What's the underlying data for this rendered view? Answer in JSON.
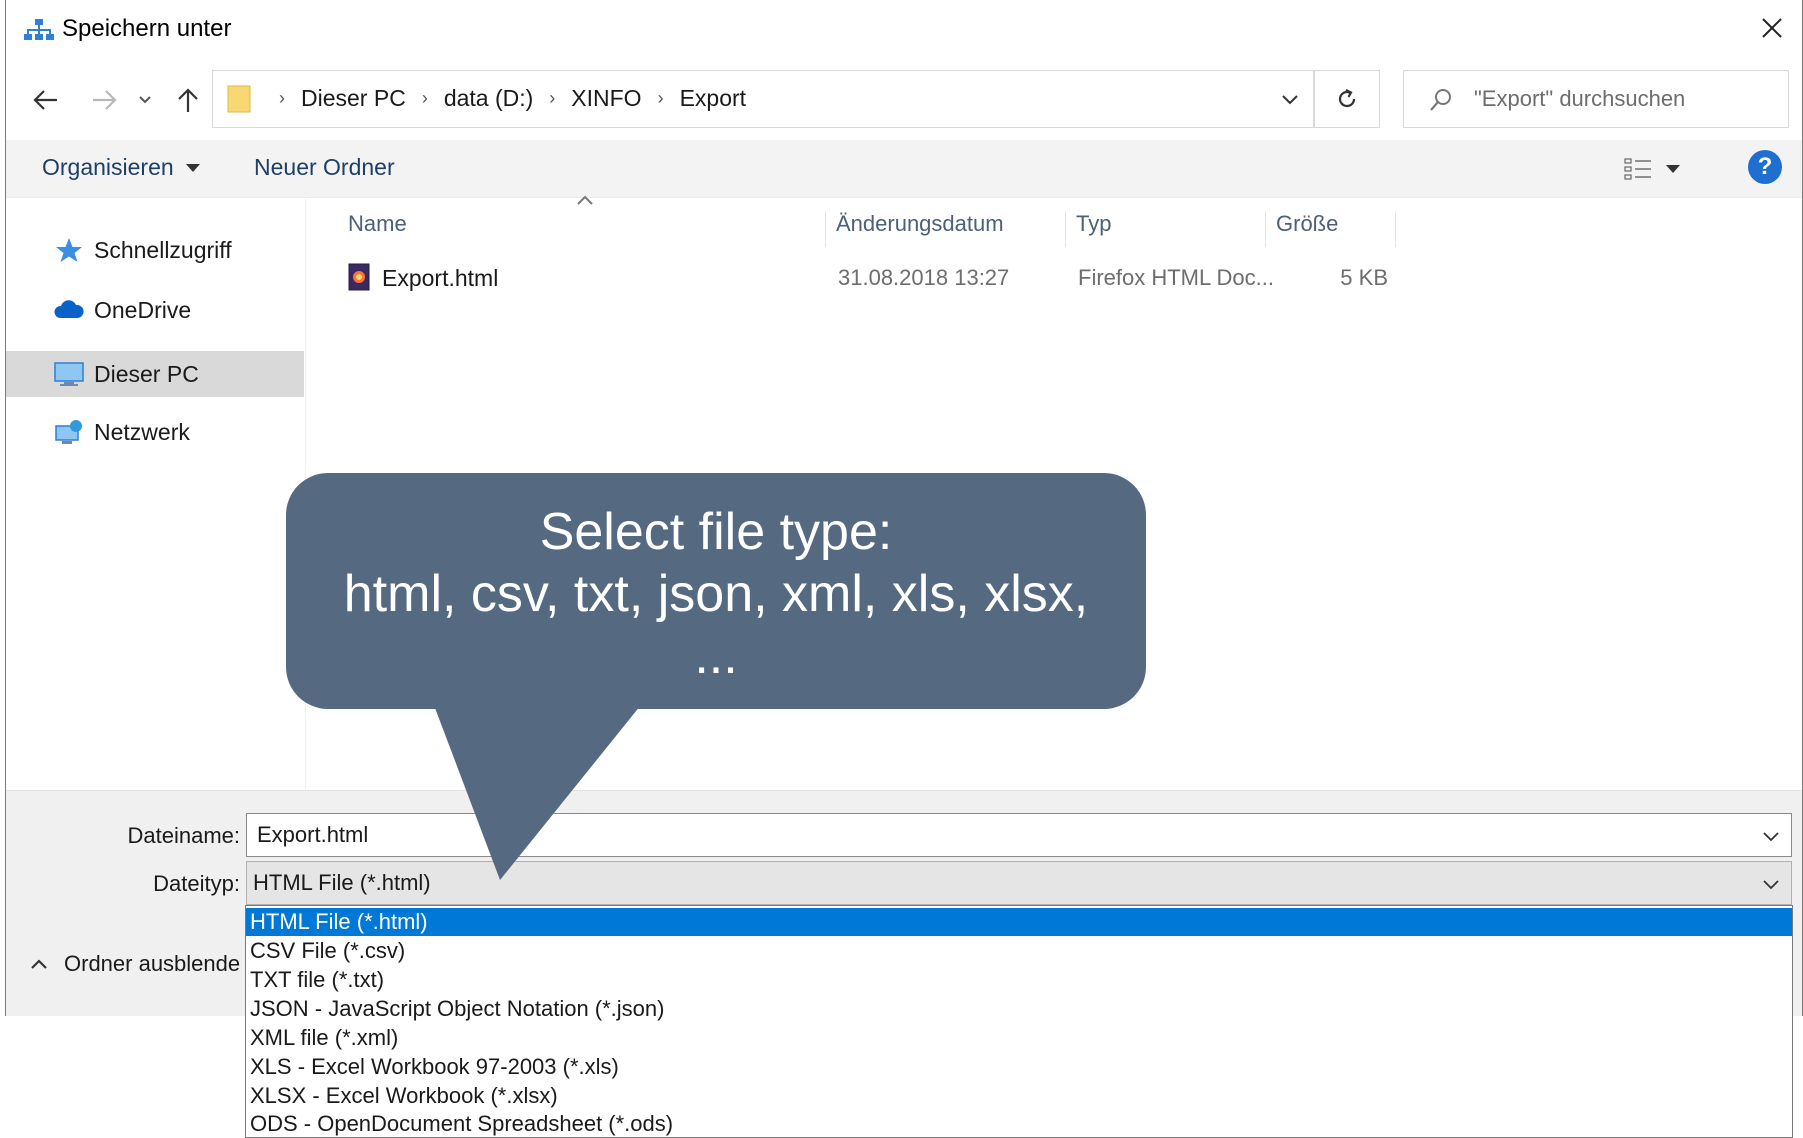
{
  "window": {
    "title": "Speichern unter"
  },
  "address": {
    "breadcrumb": [
      "Dieser PC",
      "data (D:)",
      "XINFO",
      "Export"
    ]
  },
  "search": {
    "placeholder": "\"Export\" durchsuchen"
  },
  "toolbar": {
    "organize_label": "Organisieren",
    "new_folder_label": "Neuer Ordner",
    "help_label": "?"
  },
  "sidebar": {
    "items": [
      {
        "label": "Schnellzugriff",
        "icon": "star-icon"
      },
      {
        "label": "OneDrive",
        "icon": "cloud-icon"
      },
      {
        "label": "Dieser PC",
        "icon": "computer-icon",
        "selected": true
      },
      {
        "label": "Netzwerk",
        "icon": "network-icon"
      }
    ]
  },
  "filelist": {
    "columns": [
      "Name",
      "Änderungsdatum",
      "Typ",
      "Größe"
    ],
    "rows": [
      {
        "name": "Export.html",
        "date": "31.08.2018 13:27",
        "type": "Firefox HTML Doc...",
        "size": "5 KB"
      }
    ]
  },
  "form": {
    "filename_label": "Dateiname:",
    "filename_value": "Export.html",
    "filetype_label": "Dateityp:",
    "filetype_value": "HTML File (*.html)",
    "hide_folders_label": "Ordner ausblende"
  },
  "filetype_options": [
    "HTML File (*.html)",
    "CSV File (*.csv)",
    "TXT file (*.txt)",
    "JSON - JavaScript Object Notation (*.json)",
    "XML file (*.xml)",
    "XLS - Excel Workbook 97-2003 (*.xls)",
    "XLSX - Excel Workbook (*.xlsx)",
    "ODS - OpenDocument Spreadsheet (*.ods)"
  ],
  "callout": {
    "line1": "Select file type:",
    "line2": "html, csv, txt, json, xml, xls, xlsx,",
    "line3": "..."
  },
  "colors": {
    "callout_bg": "#556a80",
    "selection": "#0078d7",
    "help": "#1e6fd0"
  }
}
